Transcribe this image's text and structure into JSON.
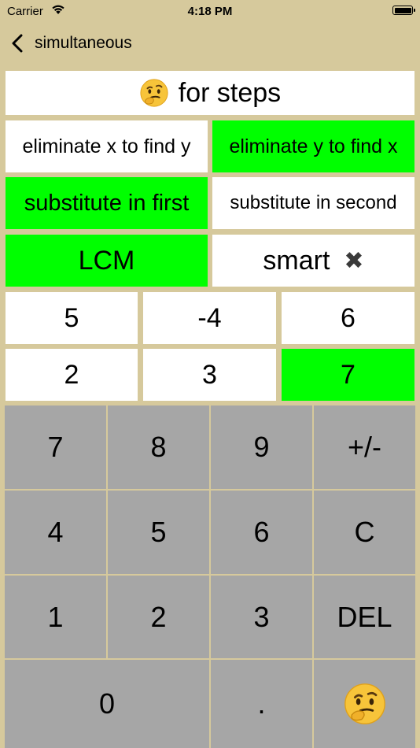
{
  "status_bar": {
    "carrier": "Carrier",
    "time": "4:18 PM"
  },
  "nav": {
    "back_label": "simultaneous"
  },
  "steps_button": {
    "label": "for steps"
  },
  "methods": {
    "eliminate_x": "eliminate x to find y",
    "eliminate_y": "eliminate y to find x",
    "substitute_first": "substitute in first",
    "substitute_second": "substitute in second",
    "lcm": "LCM",
    "smart": "smart",
    "smart_mark": "✖"
  },
  "equations": {
    "row1": [
      "5",
      "-4",
      "6"
    ],
    "row2": [
      "2",
      "3",
      "7"
    ]
  },
  "keypad": {
    "k7": "7",
    "k8": "8",
    "k9": "9",
    "plusminus": "+/-",
    "k4": "4",
    "k5": "5",
    "k6": "6",
    "clear": "C",
    "k1": "1",
    "k2": "2",
    "k3": "3",
    "delete": "DEL",
    "k0": "0",
    "dot": "."
  },
  "colors": {
    "background": "#d6c99c",
    "selected": "#00ff00",
    "key": "#a6a6a6"
  },
  "icons": {
    "thinking": "thinking-face-icon",
    "back": "chevron-left-icon",
    "close": "heavy-x-icon"
  }
}
